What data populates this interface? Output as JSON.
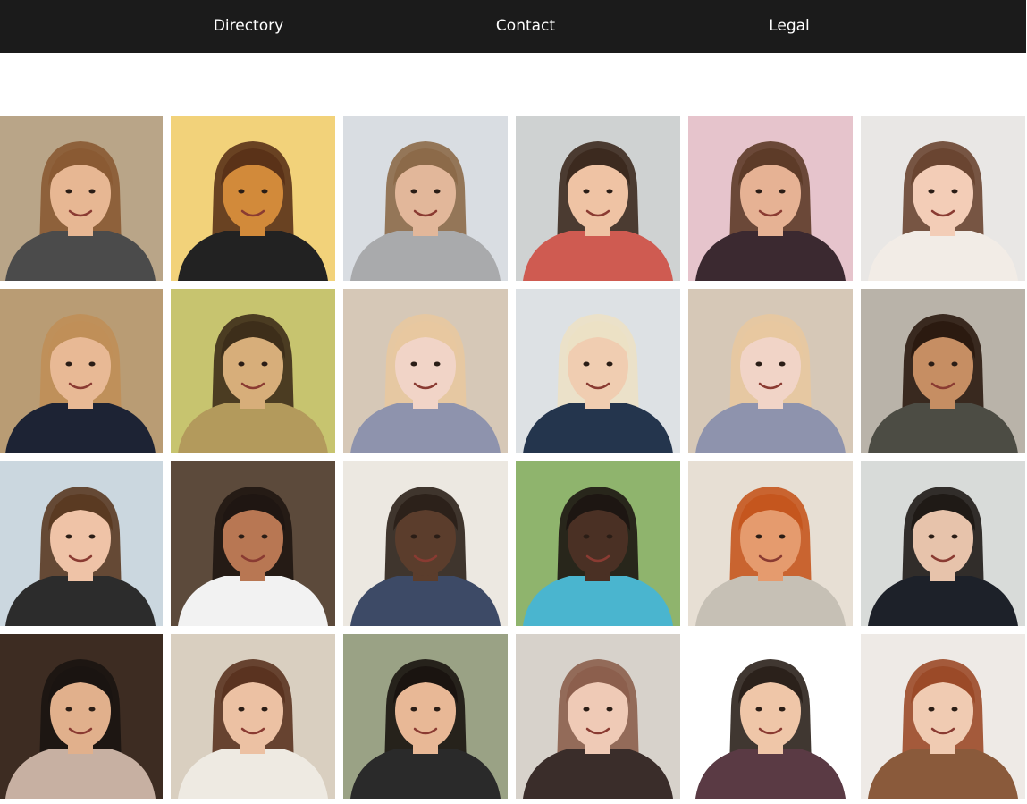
{
  "nav": {
    "items": [
      {
        "label": "Directory"
      },
      {
        "label": "Contact"
      },
      {
        "label": "Legal"
      }
    ]
  },
  "directory": {
    "photos": [
      {
        "bg": "#b9a588",
        "skin": "#e7b793",
        "hair": "#8a5a33",
        "shirt": "#4b4b4b"
      },
      {
        "bg": "#f2d27a",
        "skin": "#d28a3a",
        "hair": "#5a3218",
        "shirt": "#222222"
      },
      {
        "bg": "#d9dde2",
        "skin": "#e2b79a",
        "hair": "#8c6a49",
        "shirt": "#a9aaac"
      },
      {
        "bg": "#cfd2d2",
        "skin": "#efc3a4",
        "hair": "#3c2a1f",
        "shirt": "#cf5b51"
      },
      {
        "bg": "#e6c4cc",
        "skin": "#e6b294",
        "hair": "#5d3b28",
        "shirt": "#3b2930"
      },
      {
        "bg": "#e9e7e5",
        "skin": "#f3cdb7",
        "hair": "#6a4531",
        "shirt": "#f2ece6"
      },
      {
        "bg": "#b99c74",
        "skin": "#e8b995",
        "hair": "#c08f58",
        "shirt": "#1d2334"
      },
      {
        "bg": "#c7c46f",
        "skin": "#d7ae7a",
        "hair": "#3d2e1a",
        "shirt": "#b39a5c"
      },
      {
        "bg": "#d6c8b7",
        "skin": "#f1d4c7",
        "hair": "#e8c8a0",
        "shirt": "#8e93ad"
      },
      {
        "bg": "#dde1e4",
        "skin": "#f0cdb1",
        "hair": "#ece1c5",
        "shirt": "#24354d"
      },
      {
        "bg": "#d6c8b7",
        "skin": "#f1d4c7",
        "hair": "#e8c8a0",
        "shirt": "#8e93ad"
      },
      {
        "bg": "#b9b3a9",
        "skin": "#c68e63",
        "hair": "#2b1a10",
        "shirt": "#4c4c44"
      },
      {
        "bg": "#cbd7df",
        "skin": "#efc3a7",
        "hair": "#5a3a22",
        "shirt": "#2c2c2c"
      },
      {
        "bg": "#5c4a3b",
        "skin": "#b87753",
        "hair": "#1f1612",
        "shirt": "#f2f2f2"
      },
      {
        "bg": "#ece8e1",
        "skin": "#5b3d2c",
        "hair": "#2c211a",
        "shirt": "#3d4a66"
      },
      {
        "bg": "#8fb46d",
        "skin": "#4a3024",
        "hair": "#1d1612",
        "shirt": "#4ab5cf"
      },
      {
        "bg": "#e7dfd4",
        "skin": "#e59b6e",
        "hair": "#c5561e",
        "shirt": "#c6c0b5"
      },
      {
        "bg": "#d8dbd9",
        "skin": "#e7c3ab",
        "hair": "#1f1a16",
        "shirt": "#1d2129"
      },
      {
        "bg": "#3d2c22",
        "skin": "#e1b08c",
        "hair": "#1a1411",
        "shirt": "#c7b0a2"
      },
      {
        "bg": "#d9cfc0",
        "skin": "#ecc1a3",
        "hair": "#5a3320",
        "shirt": "#eeeae2"
      },
      {
        "bg": "#9aa285",
        "skin": "#e8b896",
        "hair": "#1a1410",
        "shirt": "#2a2a2a"
      },
      {
        "bg": "#d7d2cb",
        "skin": "#efcab6",
        "hair": "#8c5f4d",
        "shirt": "#3a2d2a"
      },
      {
        "bg": "#ffffff",
        "skin": "#efc6a8",
        "hair": "#2b211b",
        "shirt": "#5a3a44"
      },
      {
        "bg": "#eeeae6",
        "skin": "#f0cbb2",
        "hair": "#9b4a28",
        "shirt": "#8a5a3b"
      }
    ]
  }
}
